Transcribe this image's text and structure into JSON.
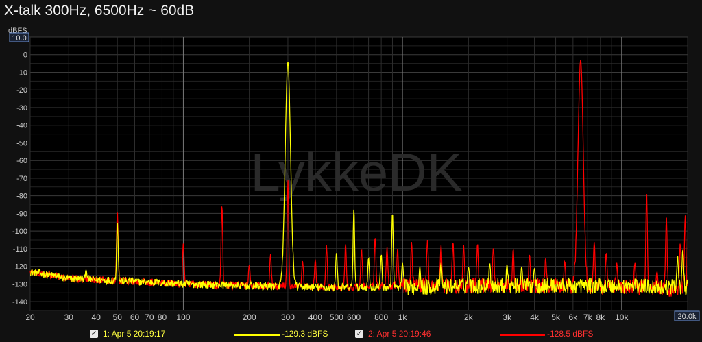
{
  "title": "X-talk 300Hz, 6500Hz ~ 60dB",
  "watermark": "LykkeDK",
  "chart_data": {
    "type": "line",
    "title": "X-talk 300Hz, 6500Hz ~ 60dB",
    "ylabel": "dBFS",
    "xscale": "log",
    "xlim": [
      20,
      20000
    ],
    "ylim": [
      -145,
      10
    ],
    "y_top_box": "10.0",
    "x_right_box": "20.0k",
    "y_ticks": [
      0,
      -10,
      -20,
      -30,
      -40,
      -50,
      -60,
      -70,
      -80,
      -90,
      -100,
      -110,
      -120,
      -130,
      -140
    ],
    "y_tick_labels": [
      "0",
      "-10",
      "-20",
      "-30",
      "-40",
      "-50",
      "-60",
      "-70",
      "-80",
      "-90",
      "-100",
      "-110",
      "-120",
      "-130",
      "-140"
    ],
    "x_ticks": [
      20,
      30,
      40,
      50,
      60,
      70,
      80,
      100,
      200,
      300,
      400,
      500,
      600,
      800,
      1000,
      2000,
      3000,
      4000,
      5000,
      6000,
      7000,
      8000,
      10000
    ],
    "x_tick_labels": [
      "20",
      "30",
      "40",
      "50",
      "60",
      "70",
      "80",
      "100",
      "200",
      "300",
      "400",
      "500",
      "600",
      "800",
      "1k",
      "2k",
      "3k",
      "4k",
      "5k",
      "6k",
      "7k",
      "8k",
      "10k"
    ],
    "grid": true,
    "series": [
      {
        "name": "1: Apr 5 20:19:17",
        "color": "#ffff00",
        "level": "-129.3 dBFS",
        "floor": [
          [
            20,
            -123
          ],
          [
            30,
            -127
          ],
          [
            50,
            -128
          ],
          [
            100,
            -130
          ],
          [
            200,
            -131
          ],
          [
            500,
            -132
          ],
          [
            1000,
            -132
          ],
          [
            2000,
            -131
          ],
          [
            5000,
            -131
          ],
          [
            10000,
            -131
          ],
          [
            20000,
            -132
          ]
        ],
        "peaks": [
          [
            36,
            -122
          ],
          [
            50,
            -95
          ],
          [
            300,
            -4
          ],
          [
            500,
            -112
          ],
          [
            600,
            -87
          ],
          [
            700,
            -115
          ],
          [
            800,
            -113
          ],
          [
            900,
            -89
          ],
          [
            1000,
            -118
          ],
          [
            1200,
            -120
          ],
          [
            1500,
            -118
          ],
          [
            2000,
            -120
          ],
          [
            2500,
            -118
          ],
          [
            3000,
            -119
          ],
          [
            3500,
            -120
          ],
          [
            4000,
            -121
          ],
          [
            18000,
            -114
          ],
          [
            19000,
            -110
          ]
        ]
      },
      {
        "name": "2: Apr 5 20:19:46",
        "color": "#ff0000",
        "level": "-128.5 dBFS",
        "floor": [
          [
            20,
            -123
          ],
          [
            30,
            -127
          ],
          [
            50,
            -128
          ],
          [
            100,
            -130
          ],
          [
            200,
            -131
          ],
          [
            500,
            -132
          ],
          [
            1000,
            -131
          ],
          [
            2000,
            -131
          ],
          [
            5000,
            -131
          ],
          [
            10000,
            -132
          ],
          [
            20000,
            -133
          ]
        ],
        "peaks": [
          [
            50,
            -89
          ],
          [
            100,
            -107
          ],
          [
            150,
            -85
          ],
          [
            200,
            -119
          ],
          [
            250,
            -113
          ],
          [
            300,
            -71
          ],
          [
            350,
            -117
          ],
          [
            400,
            -116
          ],
          [
            450,
            -108
          ],
          [
            550,
            -107
          ],
          [
            650,
            -110
          ],
          [
            750,
            -103
          ],
          [
            850,
            -109
          ],
          [
            950,
            -110
          ],
          [
            1100,
            -106
          ],
          [
            1300,
            -105
          ],
          [
            1500,
            -108
          ],
          [
            1700,
            -106
          ],
          [
            1900,
            -108
          ],
          [
            2200,
            -107
          ],
          [
            2600,
            -109
          ],
          [
            3200,
            -110
          ],
          [
            3800,
            -113
          ],
          [
            4500,
            -115
          ],
          [
            5500,
            -117
          ],
          [
            6500,
            -3
          ],
          [
            7500,
            -106
          ],
          [
            8500,
            -112
          ],
          [
            9500,
            -118
          ],
          [
            11500,
            -118
          ],
          [
            13000,
            -78
          ],
          [
            14500,
            -123
          ],
          [
            16000,
            -92
          ],
          [
            18500,
            -107
          ],
          [
            19500,
            -91
          ]
        ]
      }
    ]
  }
}
